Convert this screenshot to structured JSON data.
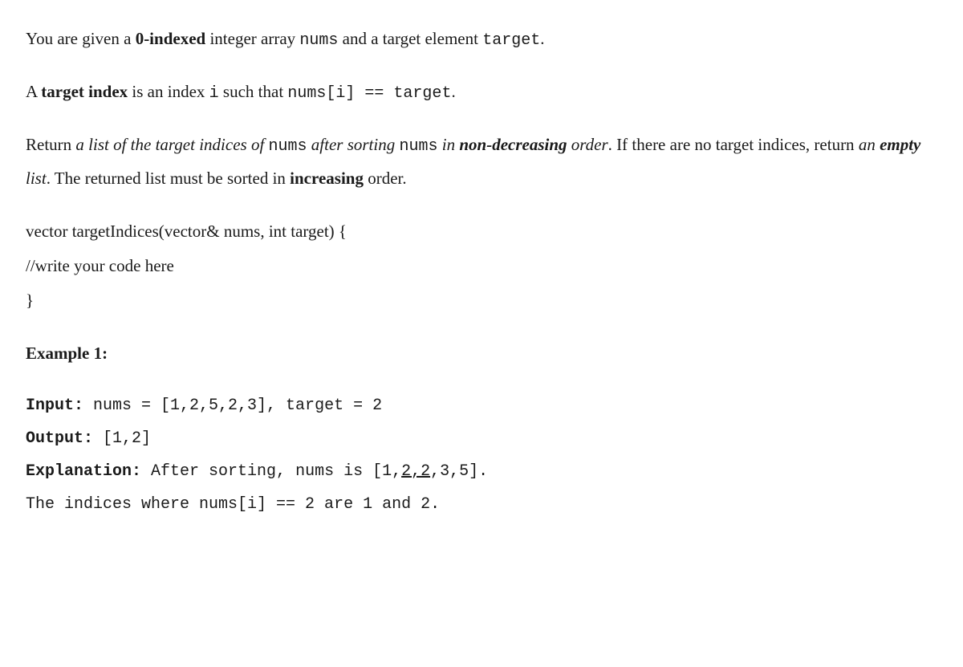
{
  "p1": {
    "t1": "You are given a ",
    "b1": "0-indexed",
    "t2": " integer array ",
    "c1": "nums",
    "t3": " and a target element ",
    "c2": "target",
    "t4": "."
  },
  "p2": {
    "t1": "A ",
    "b1": "target index",
    "t2": " is an index ",
    "c1": "i",
    "t3": " such that ",
    "c2": "nums[i] == target",
    "t4": "."
  },
  "p3": {
    "t1": "Return ",
    "i1": "a list of the target indices of ",
    "c1": "nums",
    "i2": " after sorting ",
    "c2": "nums",
    "i3": " in ",
    "bi1": "non-decreasing",
    "i4": " order",
    "t2": ". If there are no target indices, return ",
    "i5": "an ",
    "bi2": "empty",
    "i6": " list",
    "t3": ". The returned list must be sorted in ",
    "b1": "increasing",
    "t4": " order."
  },
  "sig": {
    "l1": "vector targetIndices(vector& nums, int target) {",
    "l2": "//write your code here",
    "l3": "}"
  },
  "ex_heading": "Example 1:",
  "ex": {
    "input_label": "Input:",
    "input_val": " nums = [1,2,5,2,3], target = 2",
    "output_label": "Output:",
    "output_val": " [1,2]",
    "expl_label": "Explanation:",
    "expl_t1": " After sorting, nums is [1,",
    "expl_u": "2,2",
    "expl_t2": ",3,5].",
    "expl_line2": "The indices where nums[i] == 2 are 1 and 2."
  }
}
